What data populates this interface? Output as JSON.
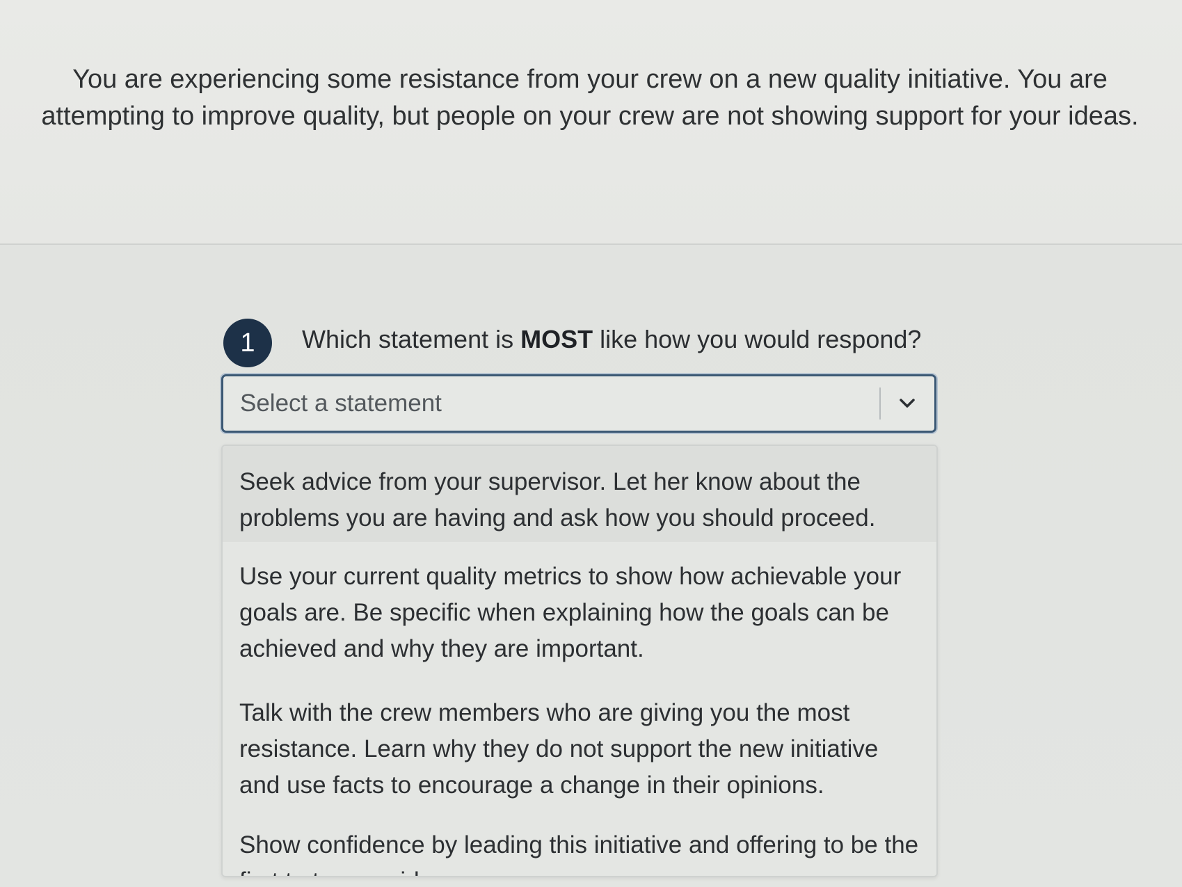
{
  "scenario": {
    "text": "You are experiencing some resistance from your crew on a new quality initiative. You are attempting to improve quality, but people on your crew are not showing support for your ideas."
  },
  "question": {
    "number": "1",
    "prefix": "Which statement is ",
    "emphasis": "MOST",
    "suffix": " like how you would respond?"
  },
  "select": {
    "placeholder": "Select a statement",
    "icon": "chevron-down-icon",
    "expanded": true
  },
  "options": [
    {
      "label": "Seek advice from your supervisor. Let her know about the problems you are having and ask how you should proceed."
    },
    {
      "label": "Use your current quality metrics to show how achievable your goals are. Be specific when explaining how the goals can be achieved and why they are important."
    },
    {
      "label": "Talk with the crew members who are giving you the most resistance. Learn why they do not support the new initiative and use facts to encourage a change in their opinions."
    },
    {
      "label": "Show confidence by leading this initiative and offering to be the first to try your ideas."
    }
  ],
  "colors": {
    "badge": "#1d3148",
    "focus_border": "#3b5874",
    "background": "#e4e6e3"
  }
}
